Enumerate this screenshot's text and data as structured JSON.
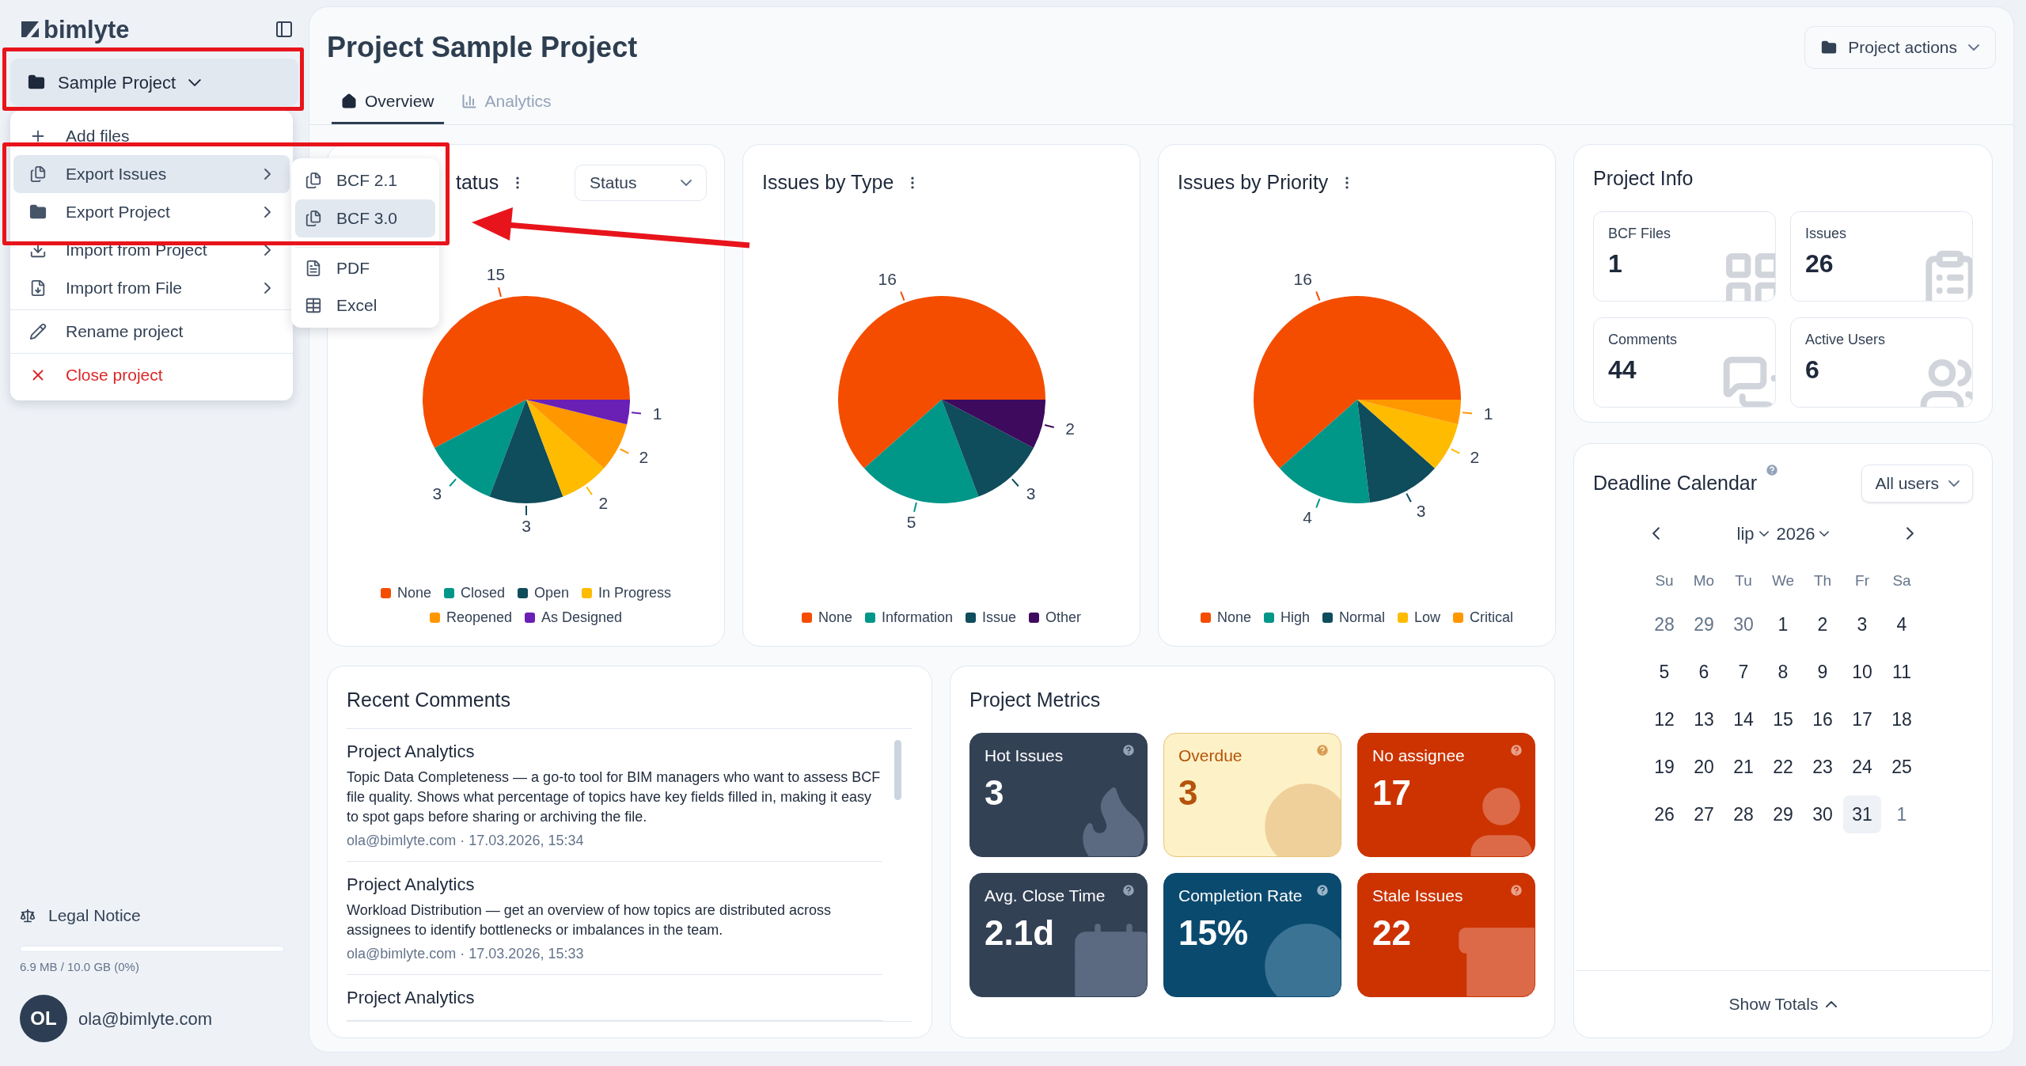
{
  "sidebar": {
    "logo": "bimlyte",
    "project": "Sample Project",
    "legal": "Legal Notice",
    "storage": {
      "level": 0,
      "label": "6.9 MB / 10.0 GB (0%)"
    },
    "user": {
      "initials": "OL",
      "email": "ola@bimlyte.com"
    }
  },
  "project_menu": {
    "items": [
      {
        "label": "Add files",
        "selected": false,
        "submenu": false,
        "danger": false,
        "divider_before": false
      },
      {
        "label": "Export Issues",
        "selected": true,
        "submenu": true,
        "danger": false,
        "divider_before": false
      },
      {
        "label": "Export Project",
        "selected": false,
        "submenu": true,
        "danger": false,
        "divider_before": false
      },
      {
        "label": "Import from Project",
        "selected": false,
        "submenu": true,
        "danger": false,
        "divider_before": false
      },
      {
        "label": "Import from File",
        "selected": false,
        "submenu": true,
        "danger": false,
        "divider_before": false
      },
      {
        "label": "Rename project",
        "selected": false,
        "submenu": false,
        "danger": false,
        "divider_before": true
      },
      {
        "label": "Close project",
        "selected": false,
        "submenu": false,
        "danger": true,
        "divider_before": true
      }
    ],
    "submenu": [
      {
        "label": "BCF 2.1",
        "selected": false,
        "divider_before": false
      },
      {
        "label": "BCF 3.0",
        "selected": true,
        "divider_before": false
      },
      {
        "label": "PDF",
        "selected": false,
        "divider_before": true
      },
      {
        "label": "Excel",
        "selected": false,
        "divider_before": false
      }
    ]
  },
  "header": {
    "title": "Project Sample Project",
    "actions": "Project actions",
    "tabs": [
      {
        "label": "Overview",
        "selected": true
      },
      {
        "label": "Analytics",
        "selected": false
      }
    ]
  },
  "charts": [
    {
      "filter": "Status",
      "legend": [
        {
          "color": "#f44d00"
        },
        {
          "color": "#009688"
        },
        {
          "color": "#0f4c5c"
        },
        {
          "color": "#ffbb00"
        },
        {
          "color": "#ff9800"
        },
        {
          "color": "#6a1fb5"
        }
      ],
      "chart_data": {
        "type": "pie",
        "title": "tatus",
        "categories": [
          "None",
          "Closed",
          "Open",
          "In Progress",
          "Reopened",
          "As Designed"
        ],
        "values": [
          15,
          3,
          3,
          2,
          2,
          1
        ],
        "data_labels": true
      }
    },
    {
      "legend": [
        {
          "color": "#f44d00"
        },
        {
          "color": "#009688"
        },
        {
          "color": "#0f4c5c"
        },
        {
          "color": "#3d0a5e"
        }
      ],
      "chart_data": {
        "type": "pie",
        "title": "Issues by Type",
        "categories": [
          "None",
          "Information",
          "Issue",
          "Other"
        ],
        "values": [
          16,
          5,
          3,
          2
        ],
        "data_labels": true
      }
    },
    {
      "legend": [
        {
          "color": "#f44d00"
        },
        {
          "color": "#009688"
        },
        {
          "color": "#0f4c5c"
        },
        {
          "color": "#ffbb00"
        },
        {
          "color": "#ff9800"
        }
      ],
      "chart_data": {
        "type": "pie",
        "title": "Issues by Priority",
        "categories": [
          "None",
          "High",
          "Normal",
          "Low",
          "Critical"
        ],
        "values": [
          16,
          4,
          3,
          2,
          1
        ],
        "data_labels": true
      }
    }
  ],
  "project_info": {
    "title": "Project Info",
    "tiles": [
      {
        "label": "BCF Files",
        "value": "1"
      },
      {
        "label": "Issues",
        "value": "26"
      },
      {
        "label": "Comments",
        "value": "44"
      },
      {
        "label": "Active Users",
        "value": "6"
      }
    ]
  },
  "calendar": {
    "title": "Deadline Calendar",
    "filter": "All users",
    "month": "lip",
    "year": "2026",
    "weekdays": [
      "Su",
      "Mo",
      "Tu",
      "We",
      "Th",
      "Fr",
      "Sa"
    ],
    "weeks": [
      [
        {
          "day": "28",
          "outside": true,
          "selected": false
        },
        {
          "day": "29",
          "outside": true,
          "selected": false
        },
        {
          "day": "30",
          "outside": true,
          "selected": false
        },
        {
          "day": "1",
          "outside": false,
          "selected": false
        },
        {
          "day": "2",
          "outside": false,
          "selected": false
        },
        {
          "day": "3",
          "outside": false,
          "selected": false
        },
        {
          "day": "4",
          "outside": false,
          "selected": false
        }
      ],
      [
        {
          "day": "5",
          "outside": false,
          "selected": false
        },
        {
          "day": "6",
          "outside": false,
          "selected": false
        },
        {
          "day": "7",
          "outside": false,
          "selected": false
        },
        {
          "day": "8",
          "outside": false,
          "selected": false
        },
        {
          "day": "9",
          "outside": false,
          "selected": false
        },
        {
          "day": "10",
          "outside": false,
          "selected": false
        },
        {
          "day": "11",
          "outside": false,
          "selected": false
        }
      ],
      [
        {
          "day": "12",
          "outside": false,
          "selected": false
        },
        {
          "day": "13",
          "outside": false,
          "selected": false
        },
        {
          "day": "14",
          "outside": false,
          "selected": false
        },
        {
          "day": "15",
          "outside": false,
          "selected": false
        },
        {
          "day": "16",
          "outside": false,
          "selected": false
        },
        {
          "day": "17",
          "outside": false,
          "selected": false
        },
        {
          "day": "18",
          "outside": false,
          "selected": false
        }
      ],
      [
        {
          "day": "19",
          "outside": false,
          "selected": false
        },
        {
          "day": "20",
          "outside": false,
          "selected": false
        },
        {
          "day": "21",
          "outside": false,
          "selected": false
        },
        {
          "day": "22",
          "outside": false,
          "selected": false
        },
        {
          "day": "23",
          "outside": false,
          "selected": false
        },
        {
          "day": "24",
          "outside": false,
          "selected": false
        },
        {
          "day": "25",
          "outside": false,
          "selected": false
        }
      ],
      [
        {
          "day": "26",
          "outside": false,
          "selected": false
        },
        {
          "day": "27",
          "outside": false,
          "selected": false
        },
        {
          "day": "28",
          "outside": false,
          "selected": false
        },
        {
          "day": "29",
          "outside": false,
          "selected": false
        },
        {
          "day": "30",
          "outside": false,
          "selected": false
        },
        {
          "day": "31",
          "outside": false,
          "selected": true
        },
        {
          "day": "1",
          "outside": true,
          "selected": false
        }
      ]
    ],
    "footer": "Show Totals"
  },
  "comments": {
    "title": "Recent Comments",
    "items": [
      {
        "title": "Project Analytics",
        "body": "Topic Data Completeness — a go-to tool for BIM managers who want to assess BCF file quality. Shows what percentage of topics have key fields filled in, making it easy to spot gaps before sharing or archiving the file.",
        "meta": "ola@bimlyte.com · 17.03.2026, 15:34"
      },
      {
        "title": "Project Analytics",
        "body": "Workload Distribution — get an overview of how topics are distributed across assignees to identify bottlenecks or imbalances in the team.",
        "meta": "ola@bimlyte.com · 17.03.2026, 15:33"
      },
      {
        "title": "Project Analytics"
      }
    ]
  },
  "metrics": {
    "title": "Project Metrics",
    "tiles": [
      {
        "label": "Hot Issues",
        "value": "3",
        "kind": "slate"
      },
      {
        "label": "Overdue",
        "value": "3",
        "kind": "amber"
      },
      {
        "label": "No assignee",
        "value": "17",
        "kind": "red"
      },
      {
        "label": "Avg. Close Time",
        "value": "2.1d",
        "kind": "slate"
      },
      {
        "label": "Completion Rate",
        "value": "15%",
        "kind": "navy"
      },
      {
        "label": "Stale Issues",
        "value": "22",
        "kind": "red"
      }
    ]
  }
}
